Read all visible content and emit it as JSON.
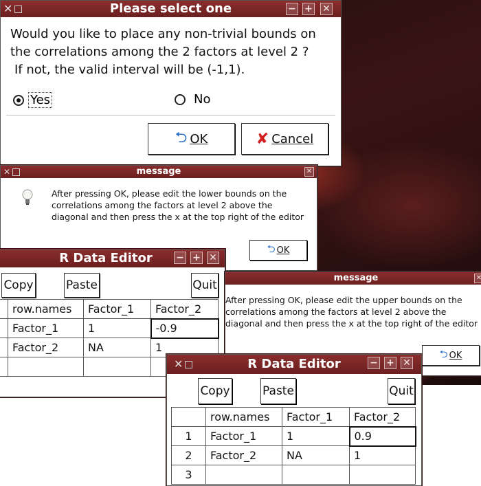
{
  "dialog_select": {
    "title": "Please select one",
    "question_line1": "Would you like to place any non-trivial bounds on",
    "question_line2": "the correlations among the 2 factors at level 2 ?",
    "question_line3": "If not, the valid interval will be (-1,1).",
    "option_yes": "Yes",
    "option_no": "No",
    "selected": "Yes",
    "ok_label": "OK",
    "cancel_label": "Cancel"
  },
  "message1": {
    "title": "message",
    "text_line1": "After pressing OK, please edit the lower bounds on the",
    "text_line2": "correlations among the factors at level 2 above the",
    "text_line3": "diagonal and then press the x at the top right of the editor",
    "ok_label": "OK"
  },
  "message2": {
    "title": "message",
    "text_line1": "After pressing OK, please edit the upper bounds on the",
    "text_line2": "correlations among the factors at level 2 above the",
    "text_line3": "diagonal and then press the x at the top right of the editor",
    "ok_label": "OK"
  },
  "editor1": {
    "title": "R Data Editor",
    "copy_label": "Copy",
    "paste_label": "Paste",
    "quit_label": "Quit",
    "headers": [
      "row.names",
      "Factor_1",
      "Factor_2"
    ],
    "rows": [
      [
        "Factor_1",
        "1",
        "-0.9"
      ],
      [
        "Factor_2",
        "NA",
        "1"
      ]
    ]
  },
  "editor2": {
    "title": "R Data Editor",
    "copy_label": "Copy",
    "paste_label": "Paste",
    "quit_label": "Quit",
    "headers": [
      "row.names",
      "Factor_1",
      "Factor_2"
    ],
    "row_numbers": [
      "1",
      "2",
      "3"
    ],
    "rows": [
      [
        "Factor_1",
        "1",
        "0.9"
      ],
      [
        "Factor_2",
        "NA",
        "1"
      ]
    ]
  },
  "icons": {
    "minimize": "minimize-icon",
    "maximize": "maximize-icon",
    "close": "close-icon",
    "bulb": "lightbulb-icon",
    "ok_arrow": "return-arrow-icon",
    "cancel_x": "red-x-icon"
  },
  "colors": {
    "titlebar": "#7a2626",
    "wallpaper": "#3a1414"
  }
}
